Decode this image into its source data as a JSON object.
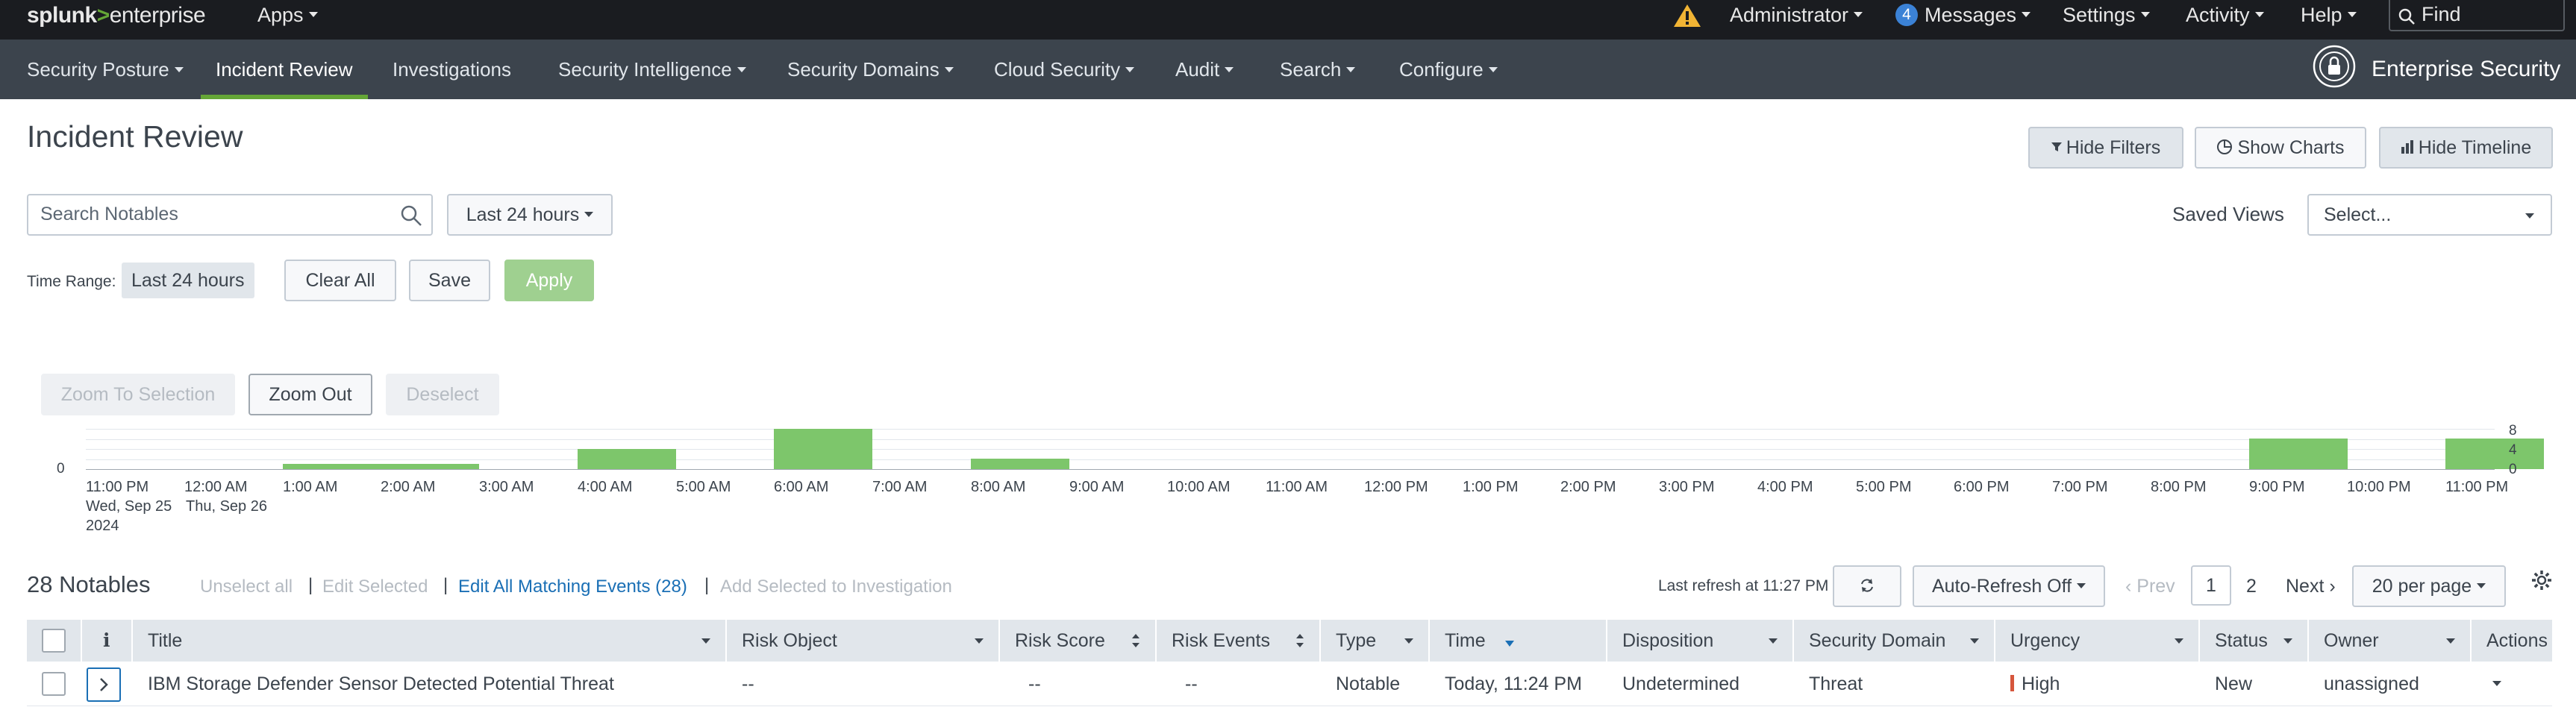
{
  "topbar": {
    "logo_splunk": "splunk",
    "logo_gt": ">",
    "logo_enterprise": "enterprise",
    "apps": "Apps",
    "user": "Administrator",
    "messages_count": "4",
    "messages": "Messages",
    "settings": "Settings",
    "activity": "Activity",
    "help": "Help",
    "find": "Find"
  },
  "nav": {
    "items": [
      "Security Posture",
      "Incident Review",
      "Investigations",
      "Security Intelligence",
      "Security Domains",
      "Cloud Security",
      "Audit",
      "Search",
      "Configure"
    ],
    "active": "Incident Review",
    "app_title": "Enterprise Security"
  },
  "page": {
    "title": "Incident Review",
    "hide_filters": "Hide Filters",
    "show_charts": "Show Charts",
    "hide_timeline": "Hide Timeline",
    "search_placeholder": "Search Notables",
    "time_picker": "Last 24 hours",
    "saved_views_label": "Saved Views",
    "saved_views_select": "Select...",
    "time_range_label": "Time Range:",
    "time_range_value": "Last 24 hours",
    "clear_all": "Clear All",
    "save": "Save",
    "apply": "Apply"
  },
  "timeline": {
    "zoom_to_selection": "Zoom To Selection",
    "zoom_out": "Zoom Out",
    "deselect": "Deselect",
    "y_left": "0",
    "y_ticks": [
      "8",
      "4",
      "0"
    ],
    "tick_labels": [
      "11:00 PM",
      "12:00 AM",
      "1:00 AM",
      "2:00 AM",
      "3:00 AM",
      "4:00 AM",
      "5:00 AM",
      "6:00 AM",
      "7:00 AM",
      "8:00 AM",
      "9:00 AM",
      "10:00 AM",
      "11:00 AM",
      "12:00 PM",
      "1:00 PM",
      "2:00 PM",
      "3:00 PM",
      "4:00 PM",
      "5:00 PM",
      "6:00 PM",
      "7:00 PM",
      "8:00 PM",
      "9:00 PM",
      "10:00 PM",
      "11:00 PM"
    ],
    "first_tick_sub1": "Wed, Sep 25",
    "first_tick_sub2": "2024",
    "second_tick_sub1": "Thu, Sep 26"
  },
  "chart_data": {
    "type": "bar",
    "categories": [
      "11:00 PM",
      "12:00 AM",
      "1:00 AM",
      "2:00 AM",
      "3:00 AM",
      "4:00 AM",
      "5:00 AM",
      "6:00 AM",
      "7:00 AM",
      "8:00 AM",
      "9:00 AM",
      "10:00 AM",
      "11:00 AM",
      "12:00 PM",
      "1:00 PM",
      "2:00 PM",
      "3:00 PM",
      "4:00 PM",
      "5:00 PM",
      "6:00 PM",
      "7:00 PM",
      "8:00 PM",
      "9:00 PM",
      "10:00 PM",
      "11:00 PM"
    ],
    "values": [
      0,
      0,
      1,
      1,
      0,
      4,
      0,
      8,
      0,
      2,
      0,
      0,
      0,
      0,
      0,
      0,
      0,
      0,
      0,
      0,
      0,
      0,
      6,
      0,
      6
    ],
    "ylim": [
      0,
      8
    ],
    "color": "#7dc66b",
    "grid": true
  },
  "notables": {
    "title": "28 Notables",
    "unselect_all": "Unselect all",
    "edit_selected": "Edit Selected",
    "edit_all": "Edit All Matching Events (28)",
    "add_to_investigation": "Add Selected to Investigation",
    "separator": "|",
    "last_refresh": "Last refresh at 11:27 PM",
    "auto_refresh": "Auto-Refresh Off",
    "prev": "Prev",
    "page_1": "1",
    "page_2": "2",
    "next": "Next",
    "per_page": "20 per page"
  },
  "table": {
    "headers": {
      "info": "i",
      "title": "Title",
      "risk_object": "Risk Object",
      "risk_score": "Risk Score",
      "risk_events": "Risk Events",
      "type": "Type",
      "time": "Time",
      "disposition": "Disposition",
      "security_domain": "Security Domain",
      "urgency": "Urgency",
      "status": "Status",
      "owner": "Owner",
      "actions": "Actions"
    },
    "rows": [
      {
        "title": "IBM Storage Defender Sensor Detected Potential Threat",
        "risk_object": "--",
        "risk_score": "--",
        "risk_events": "--",
        "type": "Notable",
        "time": "Today, 11:24 PM",
        "disposition": "Undetermined",
        "security_domain": "Threat",
        "urgency": "High",
        "status": "New",
        "owner": "unassigned"
      }
    ]
  },
  "colors": {
    "topbar": "#1a1c20",
    "navbar": "#3c444d",
    "accent_green": "#65a637",
    "link_blue": "#1a6fb5",
    "urgency_high": "#d6563c"
  }
}
